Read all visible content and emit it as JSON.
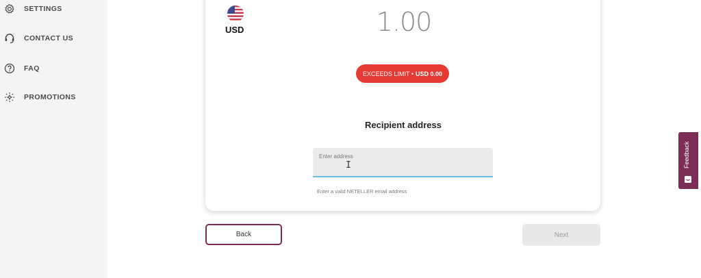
{
  "sidebar": {
    "items": [
      {
        "label": "SETTINGS",
        "icon": "gear-icon"
      },
      {
        "label": "CONTACT US",
        "icon": "headset-icon"
      },
      {
        "label": "FAQ",
        "icon": "question-circle-icon"
      },
      {
        "label": "PROMOTIONS",
        "icon": "sparkle-icon"
      }
    ]
  },
  "transfer": {
    "currency_code": "USD",
    "currency_flag": "us-flag-icon",
    "amount": "1.00",
    "limit_badge": {
      "text": "EXCEEDS LIMIT •",
      "value": "USD 0.00",
      "color": "#e63b35"
    }
  },
  "recipient": {
    "title": "Recipient address",
    "input_placeholder": "Enter address",
    "input_value": "",
    "helper_text": "Enter a valid NETELLER email address"
  },
  "actions": {
    "back_label": "Back",
    "next_label": "Next"
  },
  "feedback": {
    "label": "Feedback",
    "color": "#7d2c55"
  }
}
